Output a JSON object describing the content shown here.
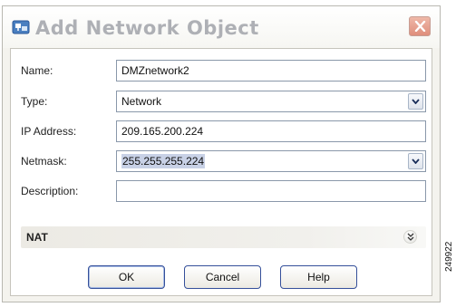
{
  "dialog": {
    "title": "Add Network Object"
  },
  "form": {
    "name": {
      "label": "Name:",
      "value": "DMZnetwork2"
    },
    "type": {
      "label": "Type:",
      "value": "Network"
    },
    "ip_address": {
      "label": "IP Address:",
      "value": "209.165.200.224"
    },
    "netmask": {
      "label": "Netmask:",
      "value": "255.255.255.224"
    },
    "description": {
      "label": "Description:",
      "value": ""
    }
  },
  "nat": {
    "label": "NAT"
  },
  "buttons": {
    "ok": "OK",
    "cancel": "Cancel",
    "help": "Help"
  },
  "figure_id": "249922"
}
